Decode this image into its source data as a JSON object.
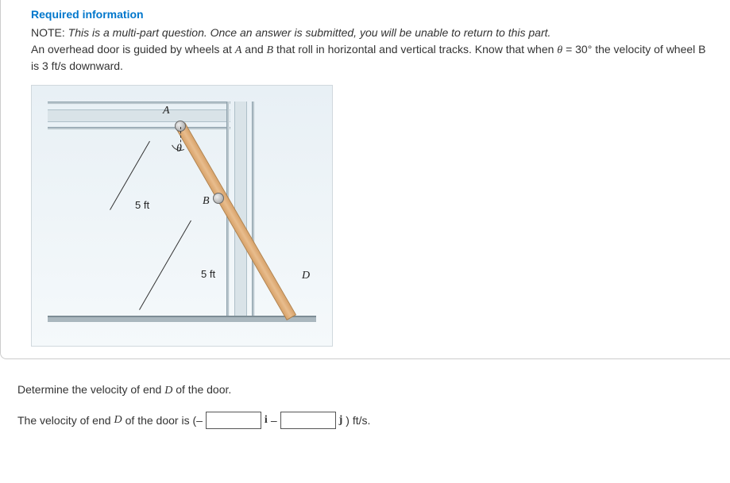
{
  "header": {
    "required_info": "Required information",
    "note_label": "NOTE:",
    "note_text": "This is a multi-part question. Once an answer is submitted, you will be unable to return to this part.",
    "description_pre": "An overhead door is guided by wheels at ",
    "var_a": "A",
    "description_mid1": " and ",
    "var_b": "B",
    "description_mid2": " that roll in horizontal and vertical tracks. Know that when ",
    "var_theta": "θ",
    "description_mid3": " = 30° the velocity of wheel B is 3 ft/s downward."
  },
  "figure": {
    "label_a": "A",
    "label_b": "B",
    "label_d": "D",
    "label_theta": "θ",
    "dim_5ft_1": "5 ft",
    "dim_5ft_2": "5 ft"
  },
  "question": {
    "prompt_pre": "Determine the velocity of end ",
    "prompt_var": "D",
    "prompt_post": " of the door.",
    "answer_pre": "The velocity of end ",
    "answer_var": "D",
    "answer_mid": " of the door is (–",
    "unit_i": "i",
    "answer_sep": " – ",
    "unit_j": "j",
    "answer_post": ") ft/s."
  }
}
